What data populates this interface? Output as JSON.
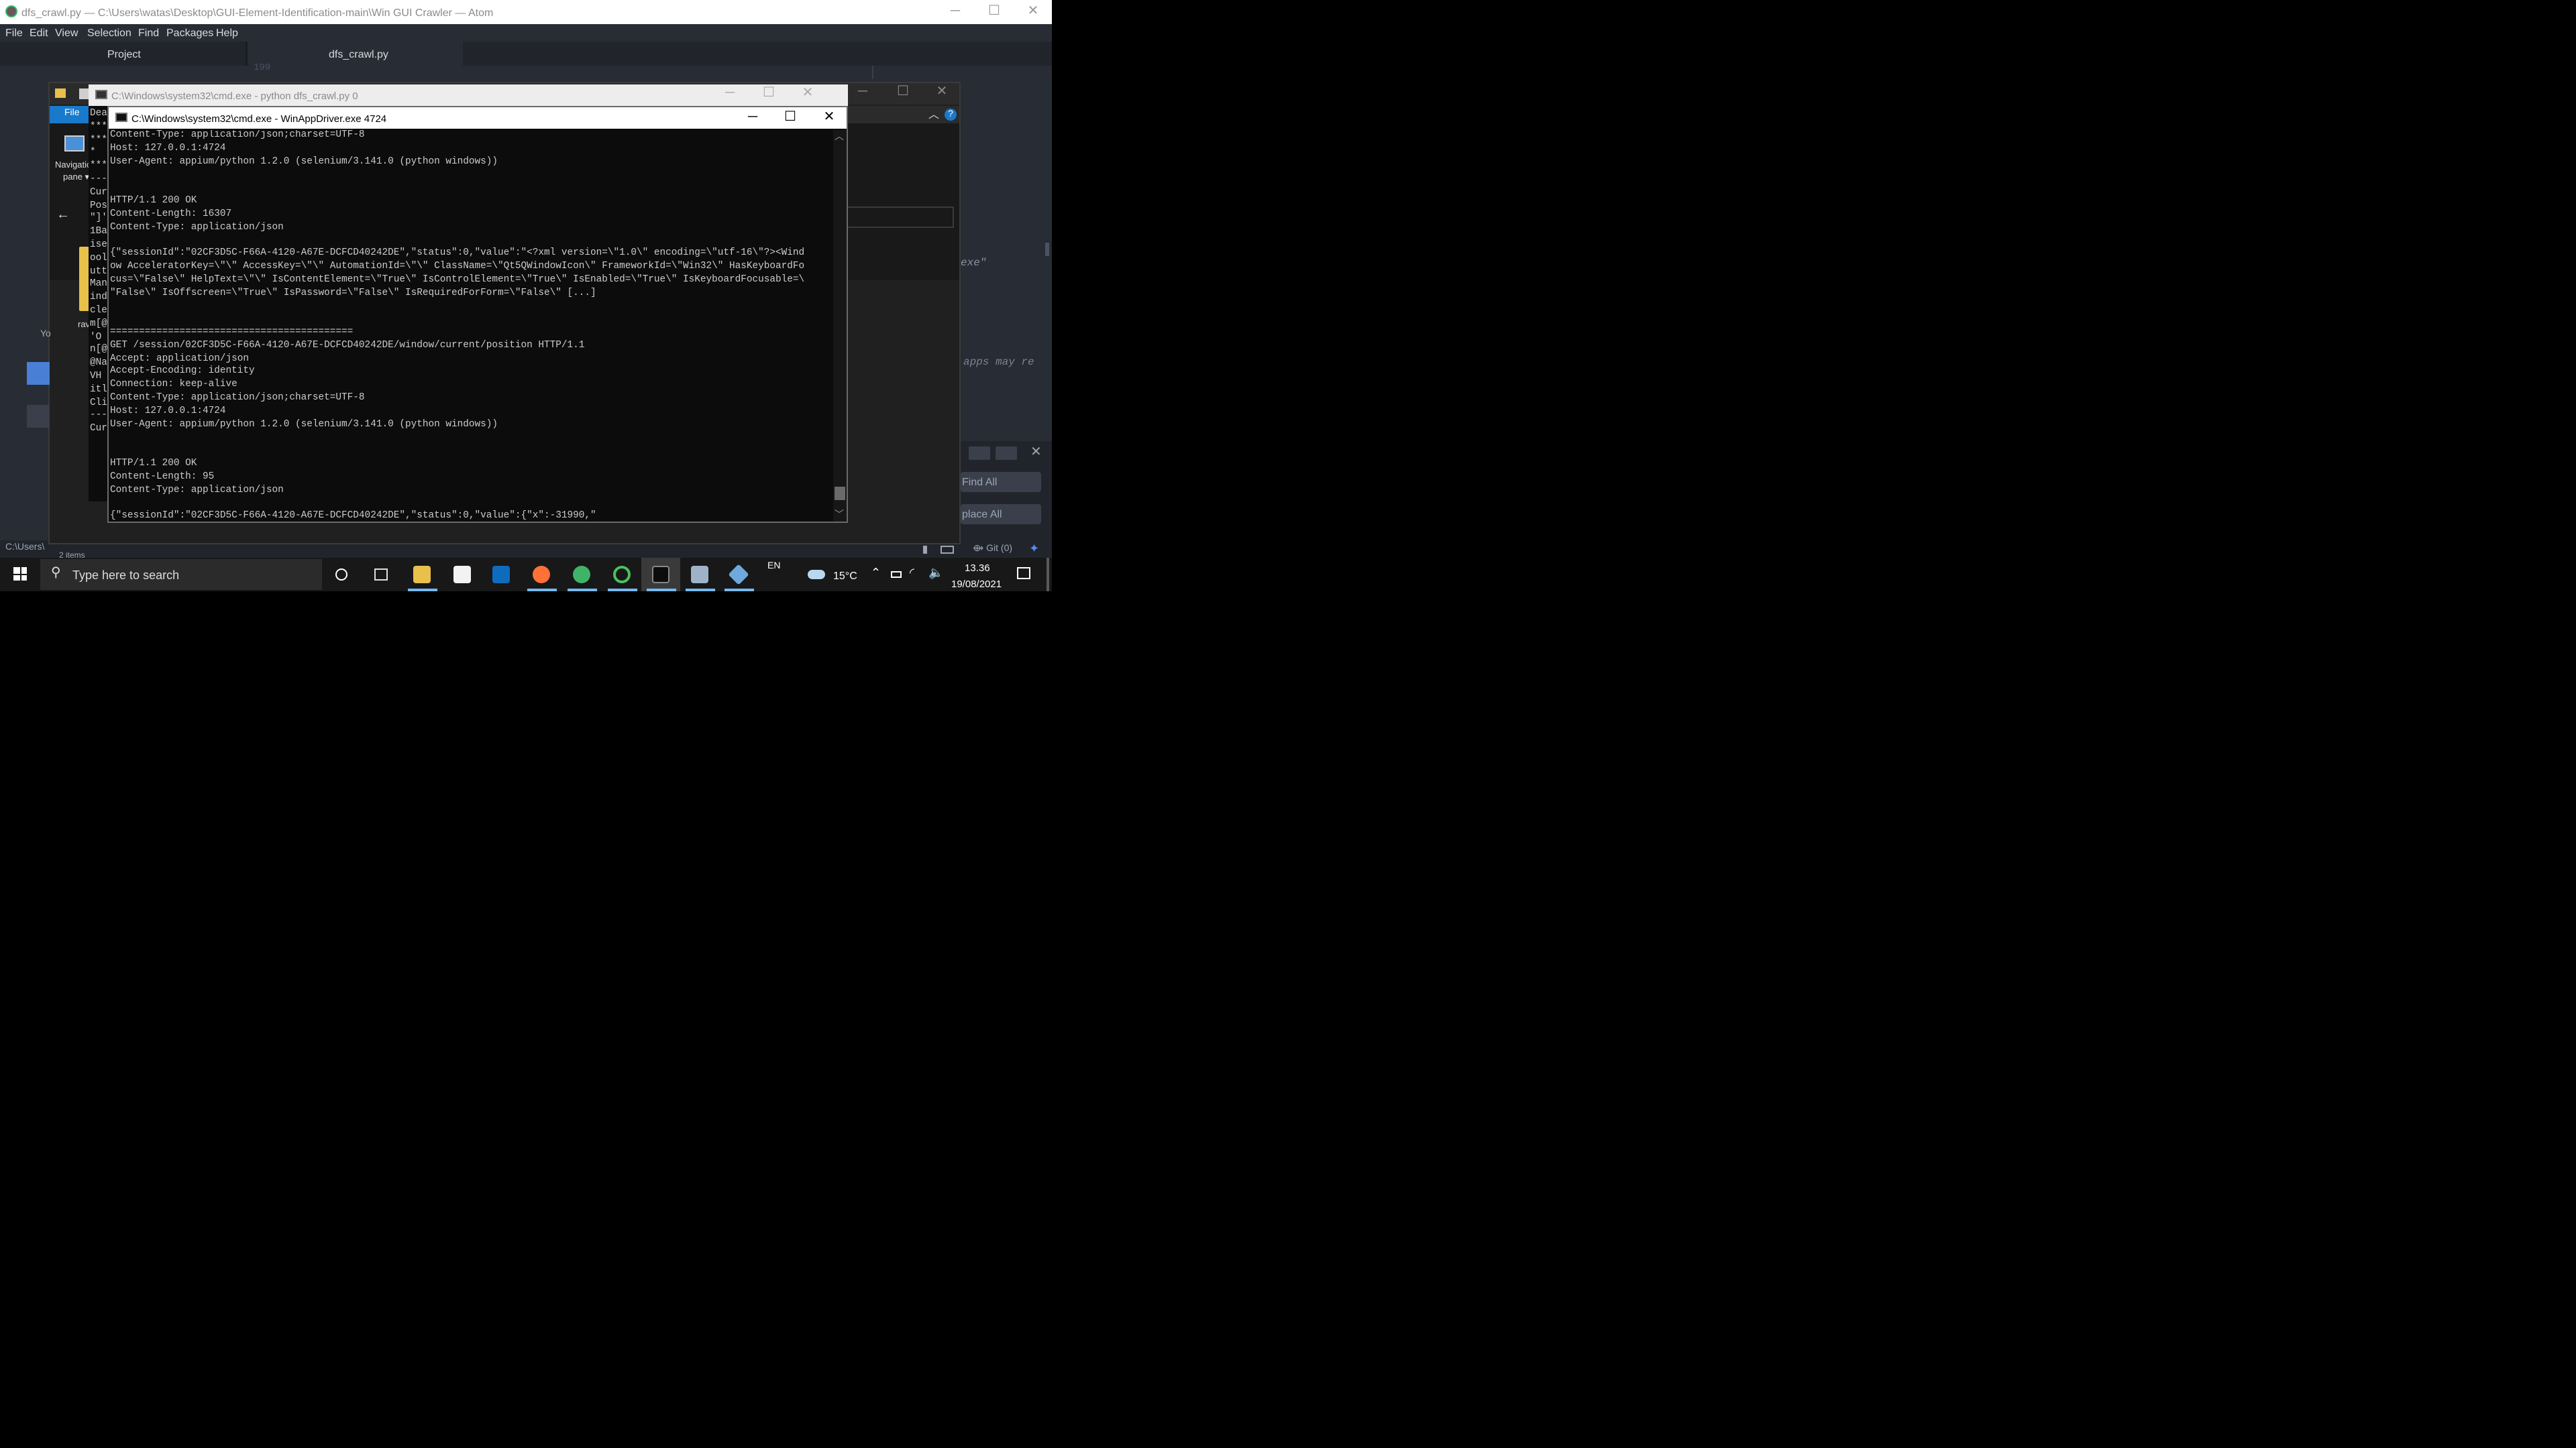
{
  "atom": {
    "title": "dfs_crawl.py — C:\\Users\\watas\\Desktop\\GUI-Element-Identification-main\\Win GUI Crawler — Atom",
    "menu": [
      "File",
      "Edit",
      "View",
      "Selection",
      "Find",
      "Packages",
      "Help"
    ],
    "tab_project": "Project",
    "tab_file": "dfs_crawl.py",
    "line_number": "199",
    "editor_fragment_1": "exe\"",
    "editor_fragment_2": "apps may re",
    "find_all": "Find All",
    "replace_all": "place All",
    "status_left": "C:\\Users\\",
    "status_items": "2 items",
    "git": "Git (0)"
  },
  "explorer": {
    "file_tab": "File",
    "nav_pane_1": "Navigatic",
    "nav_pane_2": "pane ▾",
    "side_text": [
      "Dea",
      "***",
      "***",
      "*",
      "***",
      "---",
      "Curr",
      "Pos",
      "\"]'",
      "1Ba",
      "ise",
      "ool",
      "utt",
      "Man",
      "ind",
      "cle",
      "m[@",
      "'O",
      "n[@",
      "@Na",
      "VH",
      "itl",
      "Cli",
      "---",
      "Curr"
    ],
    "folder_label": "rav",
    "left_y": "Yo",
    "c_users": "C:\\Users\\"
  },
  "cmd_back": {
    "title": "C:\\Windows\\system32\\cmd.exe - python  dfs_crawl.py 0"
  },
  "cmd_front": {
    "title": "C:\\Windows\\system32\\cmd.exe - WinAppDriver.exe  4724",
    "lines": [
      "Content-Type: application/json;charset=UTF-8",
      "Host: 127.0.0.1:4724",
      "User-Agent: appium/python 1.2.0 (selenium/3.141.0 (python windows))",
      "",
      "",
      "HTTP/1.1 200 OK",
      "Content-Length: 16307",
      "Content-Type: application/json",
      "",
      "{\"sessionId\":\"02CF3D5C-F66A-4120-A67E-DCFCD40242DE\",\"status\":0,\"value\":\"<?xml version=\\\"1.0\\\" encoding=\\\"utf-16\\\"?><Wind",
      "ow AcceleratorKey=\\\"\\\" AccessKey=\\\"\\\" AutomationId=\\\"\\\" ClassName=\\\"Qt5QWindowIcon\\\" FrameworkId=\\\"Win32\\\" HasKeyboardFo",
      "cus=\\\"False\\\" HelpText=\\\"\\\" IsContentElement=\\\"True\\\" IsControlElement=\\\"True\\\" IsEnabled=\\\"True\\\" IsKeyboardFocusable=\\",
      "\"False\\\" IsOffscreen=\\\"True\\\" IsPassword=\\\"False\\\" IsRequiredForForm=\\\"False\\\" [...]",
      "",
      "",
      "==========================================",
      "GET /session/02CF3D5C-F66A-4120-A67E-DCFCD40242DE/window/current/position HTTP/1.1",
      "Accept: application/json",
      "Accept-Encoding: identity",
      "Connection: keep-alive",
      "Content-Type: application/json;charset=UTF-8",
      "Host: 127.0.0.1:4724",
      "User-Agent: appium/python 1.2.0 (selenium/3.141.0 (python windows))",
      "",
      "",
      "HTTP/1.1 200 OK",
      "Content-Length: 95",
      "Content-Type: application/json",
      "",
      "{\"sessionId\":\"02CF3D5C-F66A-4120-A67E-DCFCD40242DE\",\"status\":0,\"value\":{\"x\":-31990,\""
    ]
  },
  "taskbar": {
    "search_placeholder": "Type here to search",
    "language": "EN",
    "temperature": "15°C",
    "time": "13.36",
    "date": "19/08/2021"
  }
}
